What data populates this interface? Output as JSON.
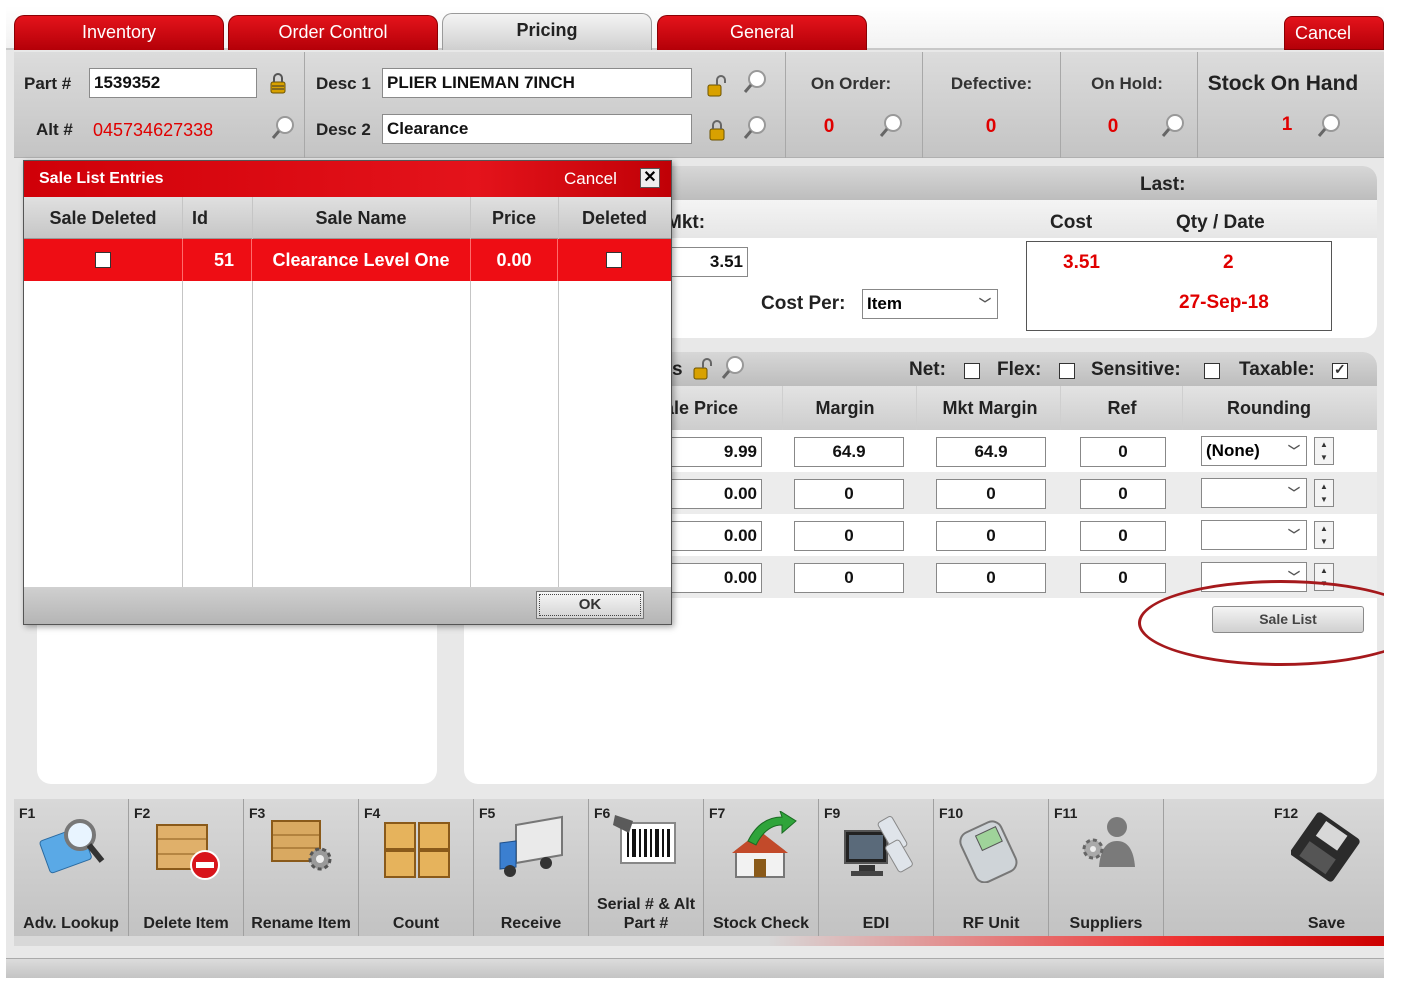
{
  "tabs": [
    {
      "label": "Inventory"
    },
    {
      "label": "Order Control"
    },
    {
      "label": "Pricing"
    },
    {
      "label": "General"
    }
  ],
  "top_cancel_label": "Cancel",
  "header": {
    "part_label": "Part #",
    "part_value": "1539352",
    "alt_label": "Alt #",
    "alt_value": "045734627338",
    "desc1_label": "Desc 1",
    "desc1_value": "PLIER LINEMAN 7INCH",
    "desc2_label": "Desc 2",
    "desc2_value": "Clearance",
    "on_order_label": "On Order:",
    "on_order_value": "0",
    "defective_label": "Defective:",
    "defective_value": "0",
    "on_hold_label": "On Hold:",
    "on_hold_value": "0",
    "stock_label": "Stock On Hand",
    "stock_value": "1"
  },
  "cost_panel": {
    "last_label": "Last:",
    "mkt_label": "Mkt:",
    "mkt_value": "3.51",
    "cost_col": "Cost",
    "qty_date_col": "Qty / Date",
    "last_cost": "3.51",
    "last_qty": "2",
    "last_date": "27-Sep-18",
    "cost_per_label": "Cost Per:",
    "cost_per_value": "Item"
  },
  "pricing_panel": {
    "s_label": "s",
    "net_label": "Net:",
    "flex_label": "Flex:",
    "sensitive_label": "Sensitive:",
    "taxable_label": "Taxable:",
    "columns": [
      "ale Price",
      "Margin",
      "Mkt Margin",
      "Ref",
      "Rounding"
    ],
    "rows": [
      {
        "price": "9.99",
        "margin": "64.9",
        "mkt_margin": "64.9",
        "ref": "0",
        "rounding": "(None)"
      },
      {
        "price": "0.00",
        "margin": "0",
        "mkt_margin": "0",
        "ref": "0",
        "rounding": ""
      },
      {
        "price": "0.00",
        "margin": "0",
        "mkt_margin": "0",
        "ref": "0",
        "rounding": ""
      },
      {
        "price": "0.00",
        "margin": "0",
        "mkt_margin": "0",
        "ref": "0",
        "rounding": ""
      }
    ],
    "sale_list_label": "Sale List"
  },
  "dialog": {
    "title": "Sale List Entries",
    "cancel_label": "Cancel",
    "columns": [
      "Sale Deleted",
      "Id",
      "Sale Name",
      "Price",
      "Deleted"
    ],
    "rows": [
      {
        "id": "51",
        "sale_name": "Clearance Level One",
        "price": "0.00"
      }
    ],
    "ok_label": "OK"
  },
  "fkeys": [
    {
      "key": "F1",
      "label": "Adv. Lookup",
      "icon": "magnifier-icon"
    },
    {
      "key": "F2",
      "label": "Delete Item",
      "icon": "crate-delete-icon"
    },
    {
      "key": "F3",
      "label": "Rename Item",
      "icon": "crate-gear-icon"
    },
    {
      "key": "F4",
      "label": "Count",
      "icon": "boxes-icon"
    },
    {
      "key": "F5",
      "label": "Receive",
      "icon": "truck-icon"
    },
    {
      "key": "F6",
      "label": "Serial # & Alt Part #",
      "icon": "barcode-scanner-icon"
    },
    {
      "key": "F7",
      "label": "Stock Check",
      "icon": "house-arrow-icon"
    },
    {
      "key": "F9",
      "label": "EDI",
      "icon": "computer-connect-icon"
    },
    {
      "key": "F10",
      "label": "RF Unit",
      "icon": "handheld-icon"
    },
    {
      "key": "F11",
      "label": "Suppliers",
      "icon": "users-gear-icon"
    },
    {
      "key": "F12",
      "label": "Save",
      "icon": "floppy-disk-icon"
    }
  ],
  "colors": {
    "accent_red": "#e4131b",
    "value_red": "#e00000"
  }
}
